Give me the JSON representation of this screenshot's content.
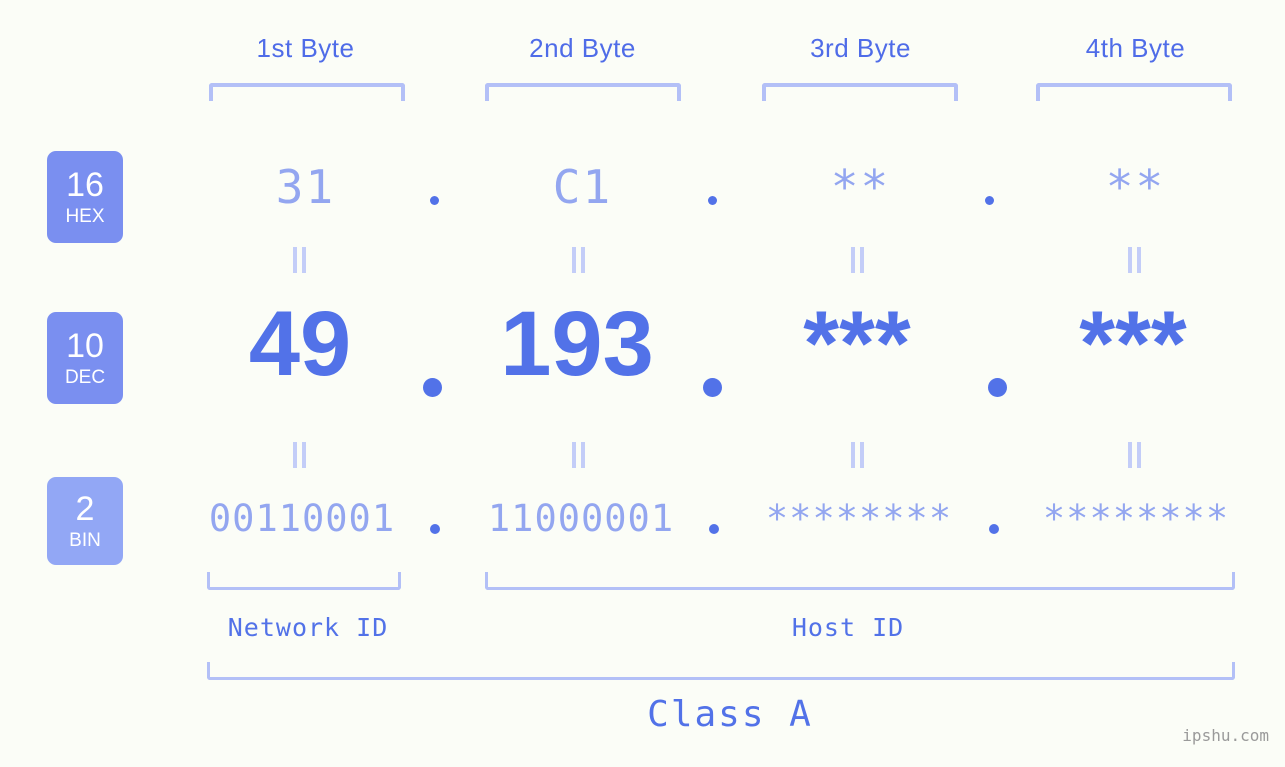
{
  "background_color": "#fbfdf7",
  "accent_color": "#5272e8",
  "light_accent_color": "#93a6f0",
  "bracket_color": "#b3c0f7",
  "byte_headers": [
    {
      "label": "1st Byte"
    },
    {
      "label": "2nd Byte"
    },
    {
      "label": "3rd Byte"
    },
    {
      "label": "4th Byte"
    }
  ],
  "bases": [
    {
      "number": "16",
      "name": "HEX",
      "badge_color": "#7a8ff0"
    },
    {
      "number": "10",
      "name": "DEC",
      "badge_color": "#7a8ff0"
    },
    {
      "number": "2",
      "name": "BIN",
      "badge_color": "#92a7f5"
    }
  ],
  "rows": {
    "hex": {
      "values": [
        "31",
        "C1",
        "**",
        "**"
      ],
      "separator": "."
    },
    "dec": {
      "values": [
        "49",
        "193",
        "***",
        "***"
      ],
      "separator": "."
    },
    "bin": {
      "values": [
        "00110001",
        "11000001",
        "********",
        "********"
      ],
      "separator": "."
    }
  },
  "equals_symbol": "=",
  "segments": {
    "network_id": "Network ID",
    "host_id": "Host ID",
    "class": "Class A"
  },
  "watermark": "ipshu.com"
}
